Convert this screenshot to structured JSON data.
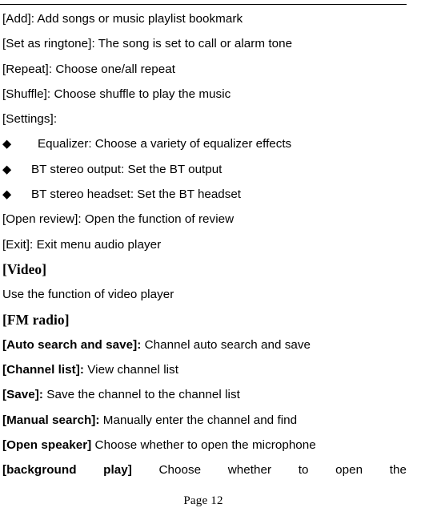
{
  "page": {
    "background_color": "#ffffff",
    "text_color": "#000000",
    "footer": "Page 12"
  },
  "audio_menu": {
    "items": [
      {
        "label": "[Add]:",
        "description": " Add songs or music playlist bookmark"
      },
      {
        "label": "[Set as ringtone]:",
        "description": " The song is set to call or alarm tone"
      },
      {
        "label": "[Repeat]:",
        "description": " Choose one/all repeat"
      },
      {
        "label": "[Shuffle]:",
        "description": " Choose shuffle to play the music"
      },
      {
        "label": "[Settings]:",
        "description": ""
      }
    ],
    "settings_bullets": [
      {
        "bullet": "◆",
        "text": "Equalizer: Choose a variety of equalizer effects",
        "indent": "wide"
      },
      {
        "bullet": "◆",
        "text": "BT stereo output: Set the BT output",
        "indent": "narrow"
      },
      {
        "bullet": "◆",
        "text": "BT stereo headset: Set the BT headset",
        "indent": "narrow"
      }
    ],
    "trailing_items": [
      {
        "label": "[Open review]:",
        "description": " Open the function of review"
      },
      {
        "label": "[Exit]:",
        "description": " Exit menu audio player"
      }
    ]
  },
  "video_section": {
    "heading": "[Video]",
    "body": "Use the function of video player"
  },
  "fm_radio_section": {
    "heading": "[FM radio]",
    "items": [
      {
        "label": "[Auto search and save]:",
        "description": " Channel auto search and save"
      },
      {
        "label": "[Channel list]:",
        "description": " View channel list"
      },
      {
        "label": "[Save]:",
        "description": " Save the channel to the channel list"
      },
      {
        "label": "[Manual search]:",
        "description": " Manually enter the channel and find"
      },
      {
        "label": "[Open speaker]",
        "description": " Choose whether to open the microphone"
      }
    ],
    "last_item": {
      "label": "[background play]",
      "description": "Choose whether to open the"
    }
  }
}
